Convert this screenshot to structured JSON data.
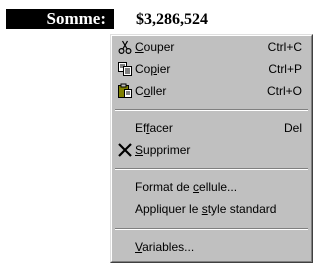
{
  "header": {
    "label": "Somme:",
    "value": "$3,286,524"
  },
  "menu": {
    "items": [
      {
        "pre": "",
        "mn": "C",
        "post": "ouper",
        "shortcut": "Ctrl+C",
        "icon": "scissors-icon"
      },
      {
        "pre": "Co",
        "mn": "p",
        "post": "ier",
        "shortcut": "Ctrl+P",
        "icon": "copy-icon"
      },
      {
        "pre": "C",
        "mn": "o",
        "post": "ller",
        "shortcut": "Ctrl+O",
        "icon": "paste-icon"
      },
      {
        "pre": "Ef",
        "mn": "f",
        "post": "acer",
        "shortcut": "Del",
        "icon": ""
      },
      {
        "pre": "",
        "mn": "S",
        "post": "upprimer",
        "shortcut": "",
        "icon": "delete-x-icon"
      },
      {
        "pre": "Format de ",
        "mn": "c",
        "post": "ellule...",
        "shortcut": "",
        "icon": ""
      },
      {
        "pre": "Appliquer le ",
        "mn": "s",
        "post": "tyle standard",
        "shortcut": "",
        "icon": ""
      },
      {
        "pre": "",
        "mn": "V",
        "post": "ariables...",
        "shortcut": "",
        "icon": ""
      }
    ]
  }
}
